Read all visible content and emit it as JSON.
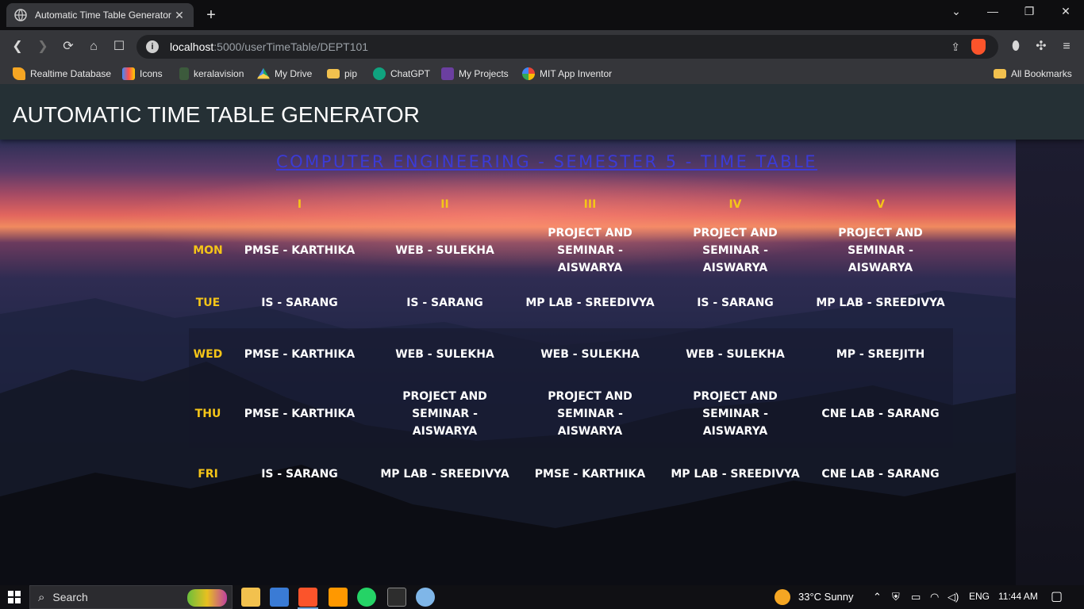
{
  "browser": {
    "tab_title": "Automatic Time Table Generator",
    "url_host": "localhost",
    "url_path": ":5000/userTimeTable/DEPT101",
    "bookmarks": [
      {
        "label": "Realtime Database",
        "icon": "firebase-icon"
      },
      {
        "label": "Icons",
        "icon": "icons-site-icon"
      },
      {
        "label": "keralavision",
        "icon": "keralavision-icon"
      },
      {
        "label": "My Drive",
        "icon": "google-drive-icon"
      },
      {
        "label": "pip",
        "icon": "folder-icon"
      },
      {
        "label": "ChatGPT",
        "icon": "chatgpt-icon"
      },
      {
        "label": "My Projects",
        "icon": "projects-icon"
      },
      {
        "label": "MIT App Inventor",
        "icon": "google-icon"
      }
    ],
    "all_bookmarks": "All Bookmarks"
  },
  "app": {
    "header_title": "AUTOMATIC TIME TABLE GENERATOR",
    "timetable_title": "COMPUTER ENGINEERING - SEMESTER 5 - TIME TABLE",
    "periods": [
      "I",
      "II",
      "III",
      "IV",
      "V"
    ],
    "rows": [
      {
        "day": "MON",
        "cells": [
          "PMSE - KARTHIKA",
          "WEB - SULEKHA",
          "PROJECT AND SEMINAR - AISWARYA",
          "PROJECT AND SEMINAR - AISWARYA",
          "PROJECT AND SEMINAR - AISWARYA"
        ]
      },
      {
        "day": "TUE",
        "cells": [
          "IS - SARANG",
          "IS - SARANG",
          "MP LAB - SREEDIVYA",
          "IS - SARANG",
          "MP LAB - SREEDIVYA"
        ]
      },
      {
        "day": "WED",
        "cells": [
          "PMSE - KARTHIKA",
          "WEB - SULEKHA",
          "WEB - SULEKHA",
          "WEB - SULEKHA",
          "MP - SREEJITH"
        ]
      },
      {
        "day": "THU",
        "cells": [
          "PMSE - KARTHIKA",
          "PROJECT AND SEMINAR - AISWARYA",
          "PROJECT AND SEMINAR - AISWARYA",
          "PROJECT AND SEMINAR - AISWARYA",
          "CNE LAB - SARANG"
        ]
      },
      {
        "day": "FRI",
        "cells": [
          "IS - SARANG",
          "MP LAB - SREEDIVYA",
          "PMSE - KARTHIKA",
          "MP LAB - SREEDIVYA",
          "CNE LAB - SARANG"
        ]
      }
    ],
    "colors": {
      "header_bg": "#253035",
      "title_link": "#3b3bd6",
      "accent": "#f5c518",
      "cell_text": "#ffffff"
    }
  },
  "taskbar": {
    "search_label": "Search",
    "weather": "33°C  Sunny",
    "language": "ENG",
    "time": "11:44 AM"
  }
}
